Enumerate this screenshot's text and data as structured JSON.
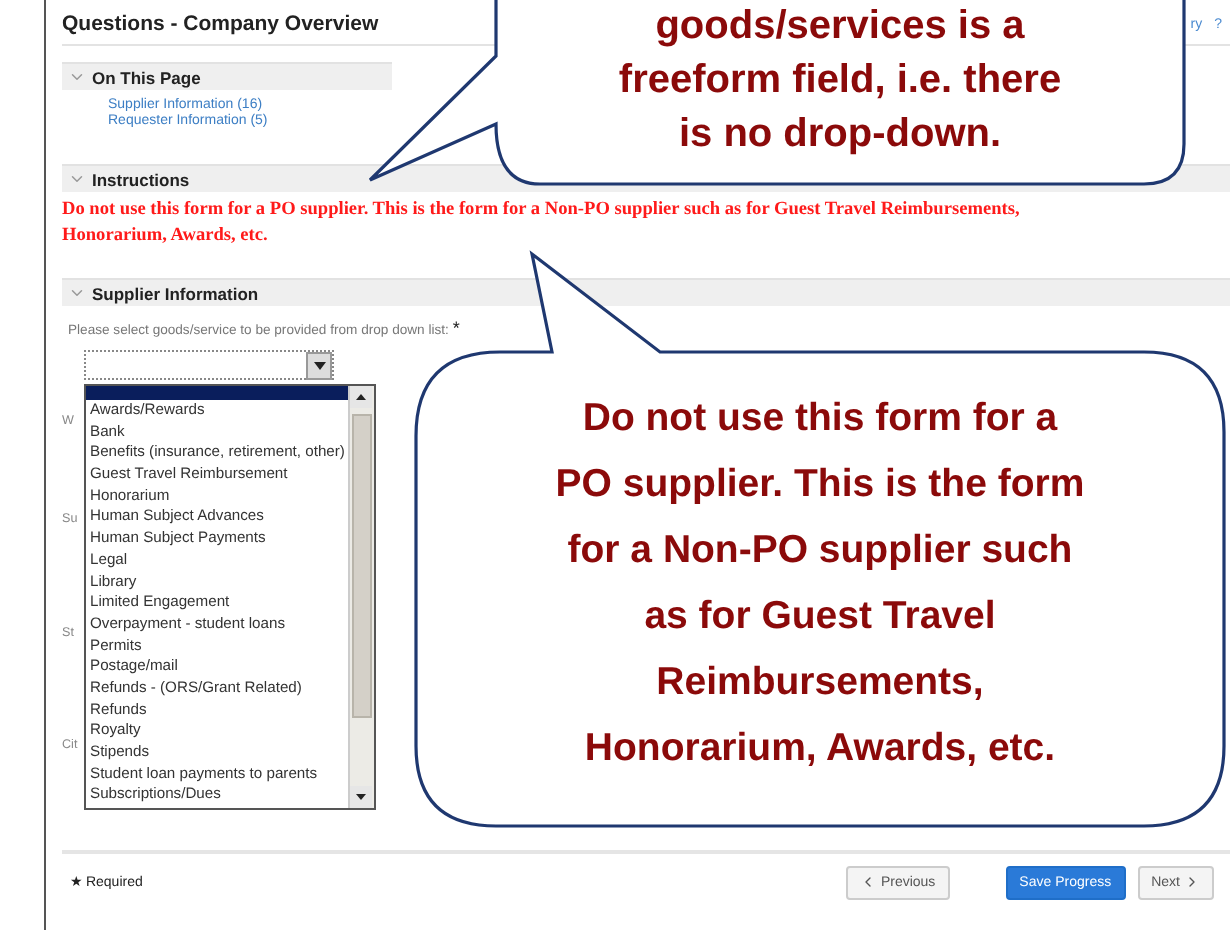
{
  "page": {
    "title": "Questions - Company Overview",
    "top_links": [
      "ry",
      "?"
    ]
  },
  "on_this_page": {
    "header": "On This Page",
    "expanded": true,
    "links": [
      "Supplier Information (16)",
      "Requester Information (5)"
    ]
  },
  "instructions": {
    "header": "Instructions",
    "expanded": true,
    "text": "Do not use this form for a PO supplier. This is the form for a Non-PO supplier such as for Guest Travel Reimbursements, Honorarium, Awards, etc."
  },
  "supplier_information": {
    "header": "Supplier Information",
    "expanded": true,
    "prompt": "Please select goods/service to be provided from drop down list:",
    "required_mark": "*",
    "hidden_labels": [
      "W",
      "Su",
      "St",
      "Cit"
    ],
    "dropdown": {
      "options": [
        {
          "selected": true
        },
        {
          "label": "Awards/Rewards",
          "selected": false
        },
        {
          "label": "Bank",
          "selected": false
        },
        {
          "label": "Benefits (insurance, retirement, other)",
          "selected": false
        },
        {
          "label": "Guest Travel Reimbursement",
          "selected": false
        },
        {
          "label": "Honorarium",
          "selected": false
        },
        {
          "label": "Human Subject Advances",
          "selected": false
        },
        {
          "label": "Human Subject Payments",
          "selected": false
        },
        {
          "label": "Legal",
          "selected": false
        },
        {
          "label": "Library",
          "selected": false
        },
        {
          "label": "Limited Engagement",
          "selected": false
        },
        {
          "label": "Overpayment - student loans",
          "selected": false
        },
        {
          "label": "Permits",
          "selected": false
        },
        {
          "label": "Postage/mail",
          "selected": false
        },
        {
          "label": "Refunds - (ORS/Grant Related)",
          "selected": false
        },
        {
          "label": "Refunds",
          "selected": false
        },
        {
          "label": "Royalty",
          "selected": false
        },
        {
          "label": "Stipends",
          "selected": false
        },
        {
          "label": "Student loan payments to parents",
          "selected": false
        },
        {
          "label": "Subscriptions/Dues",
          "selected": false
        }
      ]
    }
  },
  "footer": {
    "required_mark": "★",
    "required": "Required",
    "buttons": [
      {
        "label": "Previous",
        "kind": "previous"
      },
      {
        "label": "Save Progress",
        "kind": "primary"
      },
      {
        "label": "Next",
        "kind": "next"
      }
    ]
  },
  "callouts": [
    {
      "kind": "top",
      "lines": [
        "goods/services is a",
        "freeform field, i.e. there",
        "is no drop-down."
      ]
    },
    {
      "kind": "big",
      "lines": [
        "Do not use this form for a",
        "PO supplier. This is the form",
        "for a Non-PO supplier such",
        "as for Guest Travel",
        "Reimbursements,",
        "Honorarium, Awards, etc."
      ]
    }
  ]
}
